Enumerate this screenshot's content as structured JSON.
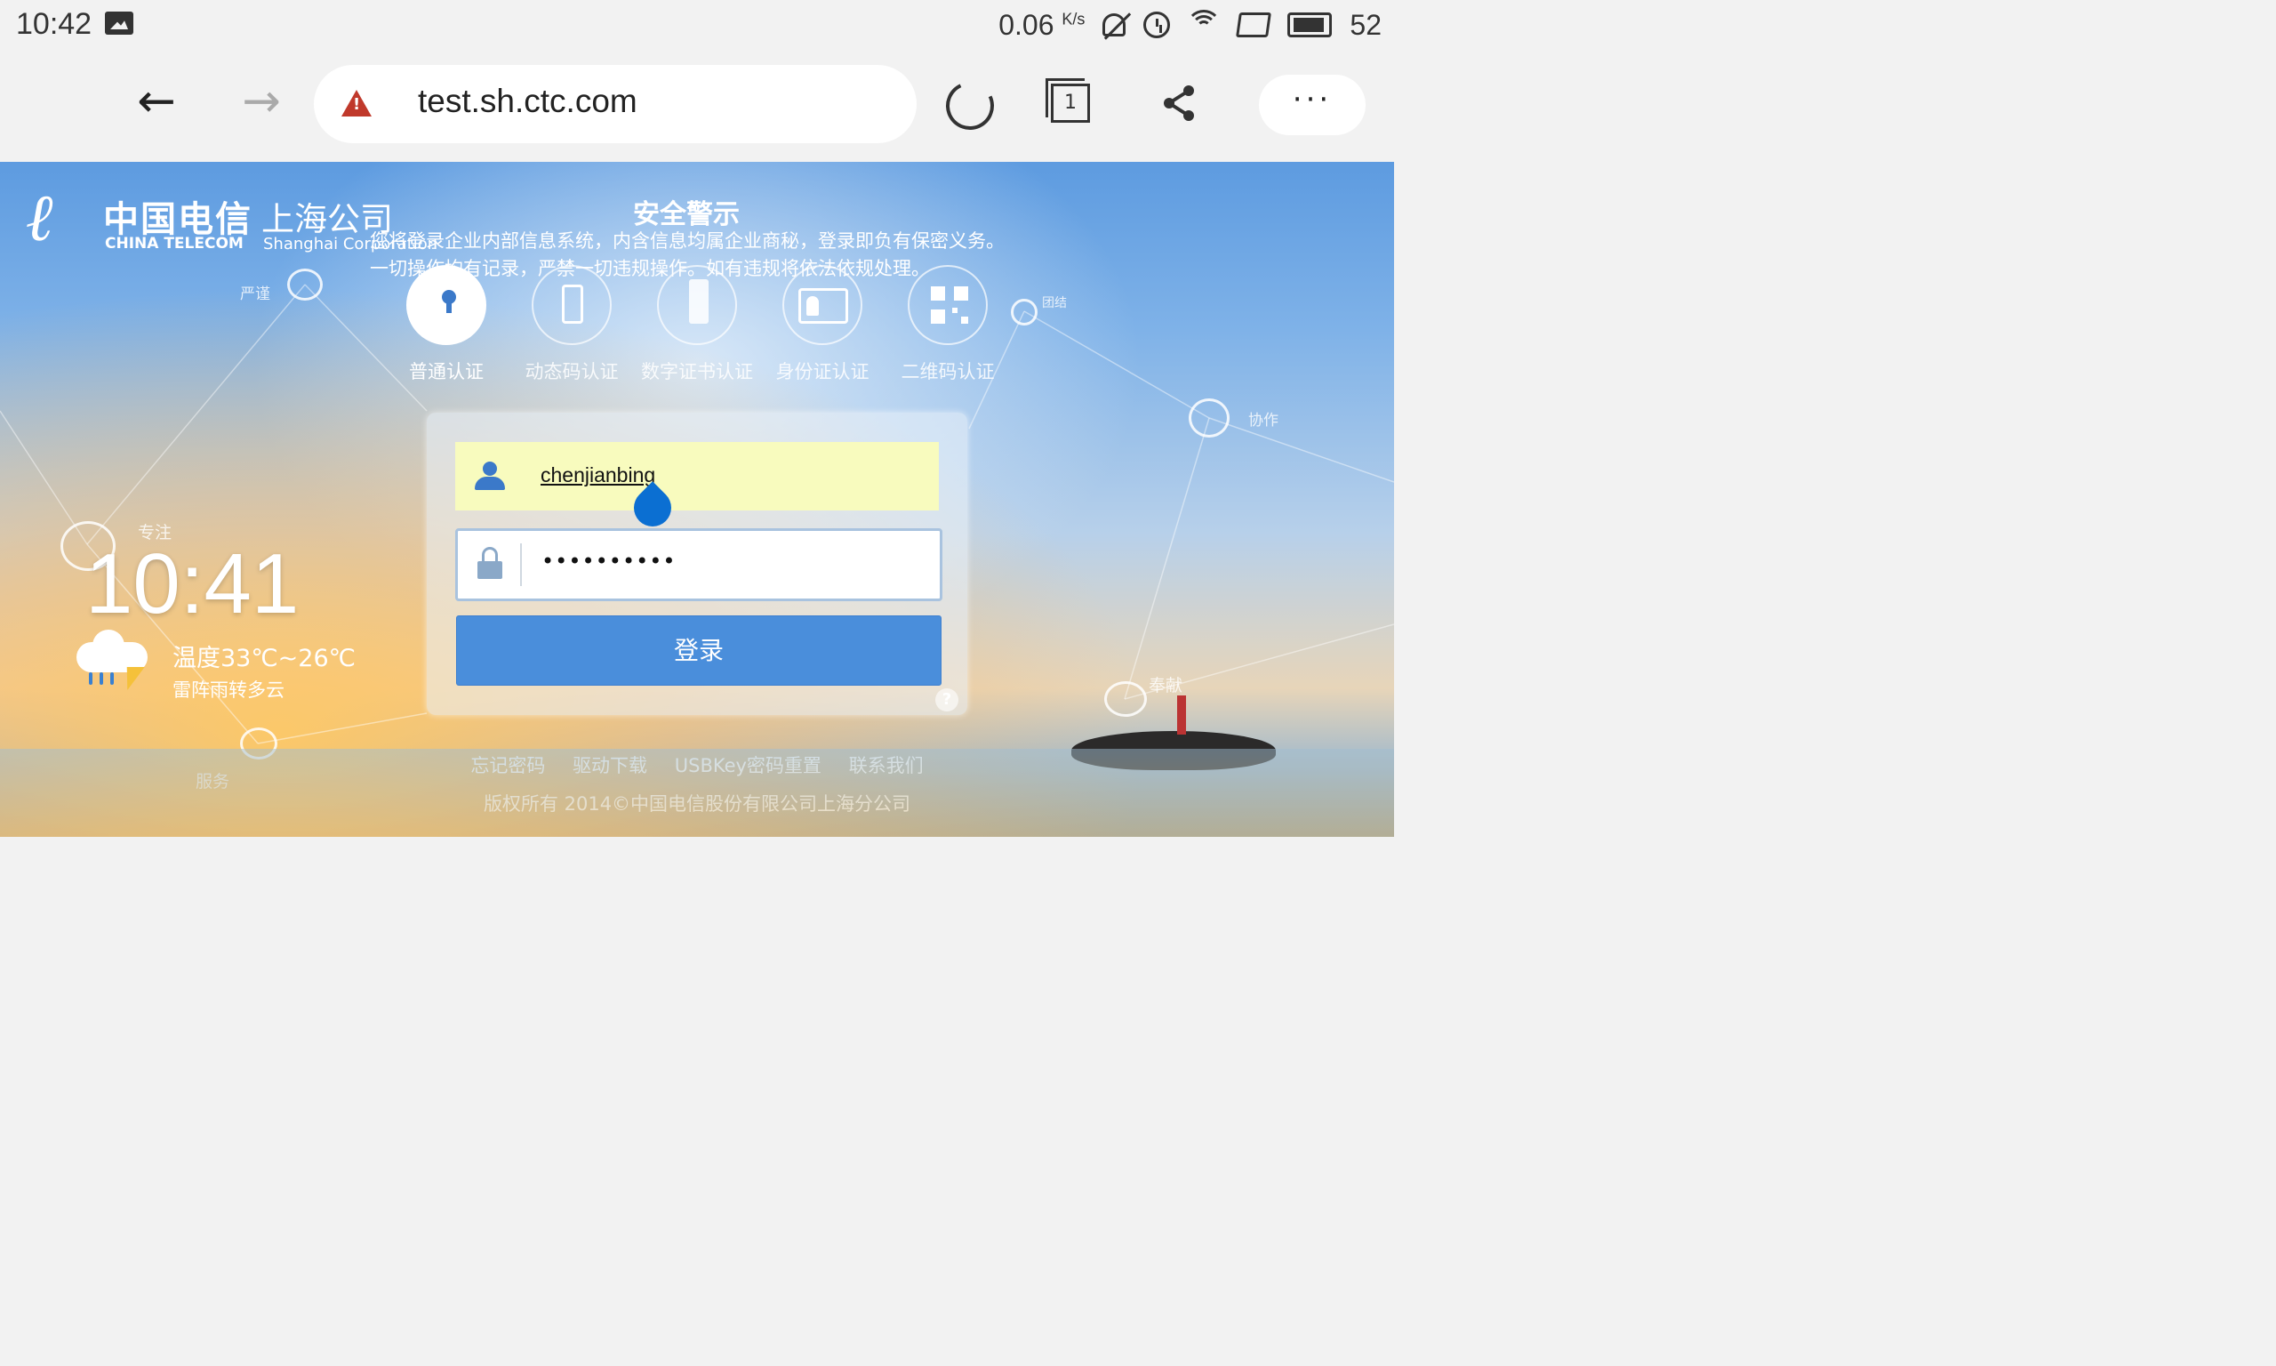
{
  "statusbar": {
    "time": "10:42",
    "speed": "0.06",
    "speed_unit": "K/s",
    "battery": "52",
    "icons": [
      "image-notification-icon",
      "mute-icon",
      "alarm-icon",
      "wifi-icon",
      "rotation-lock-icon",
      "battery-icon"
    ]
  },
  "browser": {
    "url": "test.sh.ctc.com",
    "tab_count": "1",
    "menu_label": "···",
    "back_glyph": "←",
    "forward_glyph": "→"
  },
  "logo": {
    "cn": "中国电信",
    "en": "CHINA TELECOM",
    "branch_cn": "上海公司",
    "branch_en": "Shanghai Corporation"
  },
  "warning": {
    "title": "安全警示",
    "body": "您将登录企业内部信息系统，内含信息均属企业商秘，登录即负有保密义务。一切操作均有记录，严禁一切违规操作。如有违规将依法依规处理。"
  },
  "auth_methods": [
    {
      "label": "普通认证",
      "icon": "key-icon",
      "active": true
    },
    {
      "label": "动态码认证",
      "icon": "phone-icon",
      "active": false
    },
    {
      "label": "数字证书认证",
      "icon": "usb-key-icon",
      "active": false
    },
    {
      "label": "身份证认证",
      "icon": "id-card-icon",
      "active": false
    },
    {
      "label": "二维码认证",
      "icon": "qr-code-icon",
      "active": false
    }
  ],
  "decor_labels": {
    "rigor": "严谨",
    "unity": "团结",
    "cooperation": "协作",
    "focus": "专注",
    "dedication": "奉献",
    "service": "服务"
  },
  "login": {
    "username": "chenjianbing",
    "password_mask": "••••••••••",
    "submit_label": "登录",
    "help_glyph": "?"
  },
  "clock_widget": {
    "time": "10:41",
    "temperature": "温度33℃~26℃",
    "condition": "雷阵雨转多云"
  },
  "footer": {
    "links": [
      "忘记密码",
      "驱动下载",
      "USBKey密码重置",
      "联系我们"
    ],
    "copyright": "版权所有 2014©中国电信股份有限公司上海分公司"
  },
  "colors": {
    "primary_button": "#4a8edb",
    "autofill": "#f8fbbe",
    "warning_icon": "#c0392b"
  }
}
